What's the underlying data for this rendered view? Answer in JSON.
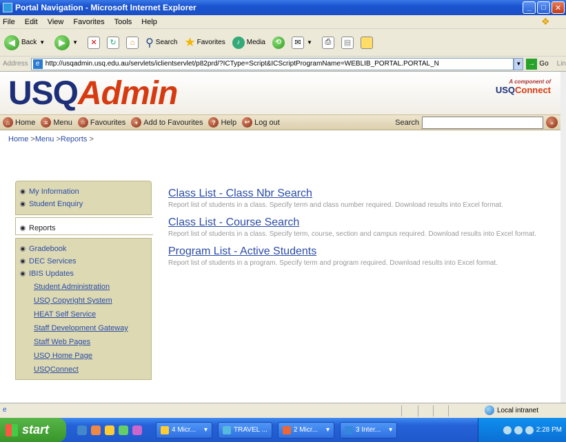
{
  "window": {
    "title": "Portal Navigation - Microsoft Internet Explorer"
  },
  "menu": [
    "File",
    "Edit",
    "View",
    "Favorites",
    "Tools",
    "Help"
  ],
  "toolbar": {
    "back": "Back",
    "search": "Search",
    "favorites": "Favorites",
    "media": "Media"
  },
  "address": {
    "label": "Address",
    "url": "http://usqadmin.usq.edu.au/servlets/iclientservlet/p82prd/?ICType=Script&ICScriptProgramName=WEBLIB_PORTAL.PORTAL_N",
    "go": "Go",
    "links": "Lin"
  },
  "header": {
    "logo_usq": "USQ",
    "logo_admin": "Admin",
    "component_of": "A component of",
    "connect_usq": "USQ",
    "connect_connect": "Connect"
  },
  "nav": {
    "home": "Home",
    "menu": "Menu",
    "favourites": "Favourites",
    "add_favourites": "Add to Favourites",
    "help": "Help",
    "logout": "Log out",
    "search_label": "Search"
  },
  "breadcrumb": {
    "home": "Home",
    "menu": "Menu",
    "reports": "Reports",
    "sep": ">"
  },
  "sidebar": {
    "top": [
      "My Information",
      "Student Enquiry"
    ],
    "selected": "Reports",
    "bottom": [
      "Gradebook",
      "DEC Services",
      "IBIS Updates"
    ],
    "links": [
      "Student Administration",
      "USQ Copyright System",
      "HEAT Self Service",
      "Staff Development Gateway",
      "Staff Web Pages",
      "USQ Home Page",
      "USQConnect"
    ]
  },
  "reports": [
    {
      "title": "Class List - Class Nbr Search",
      "desc": "Report list of students in a class. Specify term and class number required. Download results into Excel format."
    },
    {
      "title": "Class List - Course Search",
      "desc": "Report list of students in a class. Specify term, course, section and campus required. Download results into Excel format."
    },
    {
      "title": "Program List - Active Students",
      "desc": "Report list of students in a program. Specify term and program required. Download results into Excel format."
    }
  ],
  "status": {
    "zone": "Local intranet"
  },
  "taskbar": {
    "start": "start",
    "tasks": [
      "4 Micr...",
      "TRAVEL ...",
      "2 Micr...",
      "3 Inter..."
    ],
    "clock": "2:28 PM"
  }
}
